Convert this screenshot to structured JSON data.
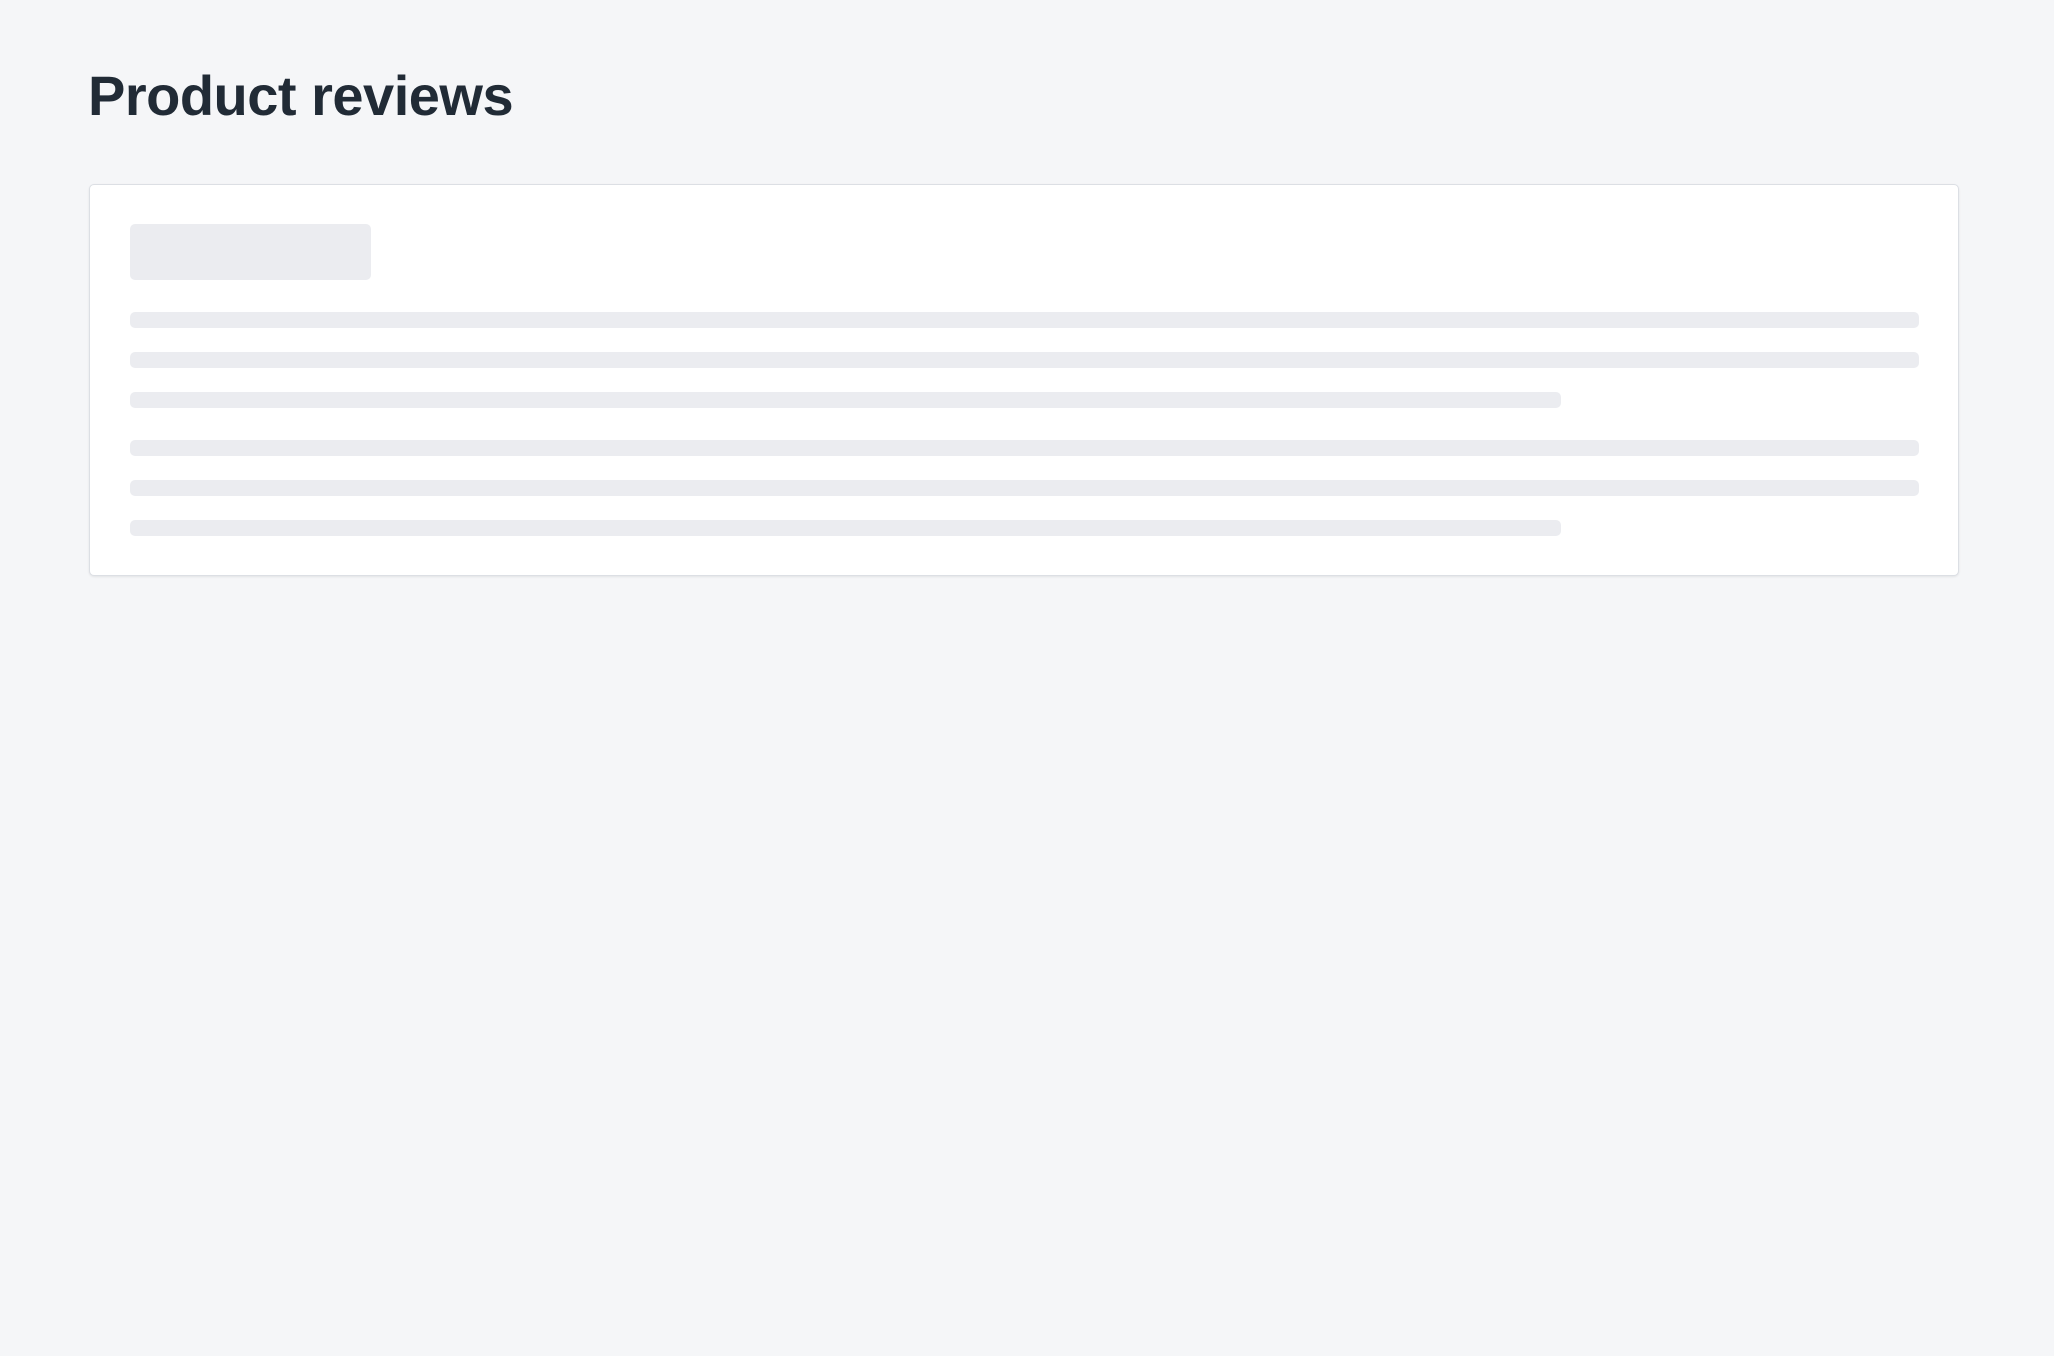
{
  "page": {
    "title": "Product reviews"
  },
  "review_card": {
    "state": "loading",
    "skeleton_groups": [
      {
        "lines": [
          "full",
          "full",
          "short"
        ]
      },
      {
        "lines": [
          "full",
          "full",
          "short"
        ]
      }
    ]
  },
  "colors": {
    "background": "#f5f6f8",
    "card": "#ffffff",
    "card_border": "#dcdfe4",
    "skeleton": "#ebecf0",
    "title_text": "#212b36"
  }
}
